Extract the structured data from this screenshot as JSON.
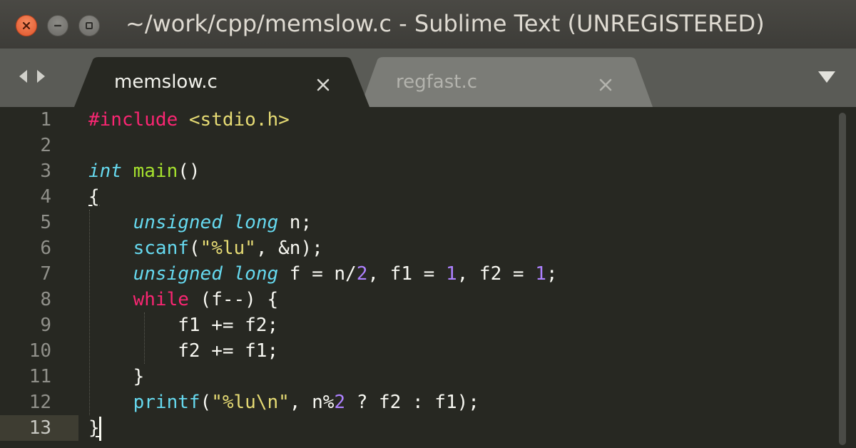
{
  "window": {
    "title": "~/work/cpp/memslow.c - Sublime Text (UNREGISTERED)",
    "buttons": [
      "close",
      "minimize",
      "maximize"
    ]
  },
  "tabs": [
    {
      "label": "memslow.c",
      "active": true
    },
    {
      "label": "regfast.c",
      "active": false
    }
  ],
  "editor": {
    "line_numbers": [
      "1",
      "2",
      "3",
      "4",
      "5",
      "6",
      "7",
      "8",
      "9",
      "10",
      "11",
      "12",
      "13"
    ],
    "active_line": 13,
    "tokens": {
      "l1_include": "#include",
      "l1_header": "<stdio.h>",
      "l3_int": "int",
      "l3_main": "main",
      "l3_parens": "()",
      "l4_brace": "{",
      "l5_unsigned": "unsigned",
      "l5_long": "long",
      "l5_rest": " n;",
      "l6_scanf": "scanf",
      "l6_open": "(",
      "l6_str": "\"%lu\"",
      "l6_rest": ", &n);",
      "l7_unsigned": "unsigned",
      "l7_long": "long",
      "l7_a": " f = n/",
      "l7_2": "2",
      "l7_b": ", f1 = ",
      "l7_1a": "1",
      "l7_c": ", f2 = ",
      "l7_1b": "1",
      "l7_d": ";",
      "l8_while": "while",
      "l8_rest": " (f--) {",
      "l9": "f1 += f2;",
      "l10": "f2 += f1;",
      "l11": "}",
      "l12_printf": "printf",
      "l12_open": "(",
      "l12_str": "\"%lu\\n\"",
      "l12_a": ", n%",
      "l12_2": "2",
      "l12_b": " ? f2 : f1);",
      "l13_brace": "}"
    }
  },
  "colors": {
    "background": "#272822",
    "keyword": "#f92672",
    "string": "#e6db74",
    "type": "#66d9ef",
    "function": "#a6e22e",
    "number": "#ae81ff",
    "close_button": "#e0552c"
  },
  "icons": [
    "close-icon",
    "minimize-icon",
    "maximize-icon",
    "arrow-left-icon",
    "arrow-right-icon",
    "tab-close-icon",
    "chevron-down-icon"
  ]
}
